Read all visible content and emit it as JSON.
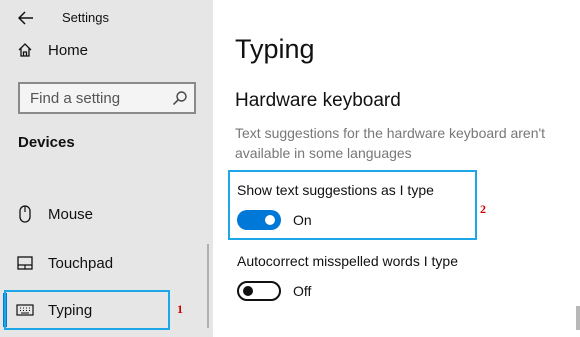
{
  "app": {
    "title": "Settings"
  },
  "sidebar": {
    "home_label": "Home",
    "search_placeholder": "Find a setting",
    "section_heading": "Devices",
    "items": [
      {
        "label": "Mouse",
        "icon": "mouse-icon"
      },
      {
        "label": "Touchpad",
        "icon": "touchpad-icon"
      },
      {
        "label": "Typing",
        "icon": "keyboard-icon",
        "selected": true
      }
    ]
  },
  "main": {
    "page_title": "Typing",
    "section_title": "Hardware keyboard",
    "description": "Text suggestions for the hardware keyboard aren't available in some languages",
    "settings": [
      {
        "label": "Show text suggestions as I type",
        "state": "On",
        "enabled": true
      },
      {
        "label": "Autocorrect misspelled words I type",
        "state": "Off",
        "enabled": false
      }
    ]
  },
  "annotations": {
    "marker_1": "1",
    "marker_2": "2"
  },
  "colors": {
    "accent": "#0078d7",
    "highlight": "#1ea7e6",
    "marker": "#d00000",
    "sidebar_bg": "#e6e6e6"
  }
}
